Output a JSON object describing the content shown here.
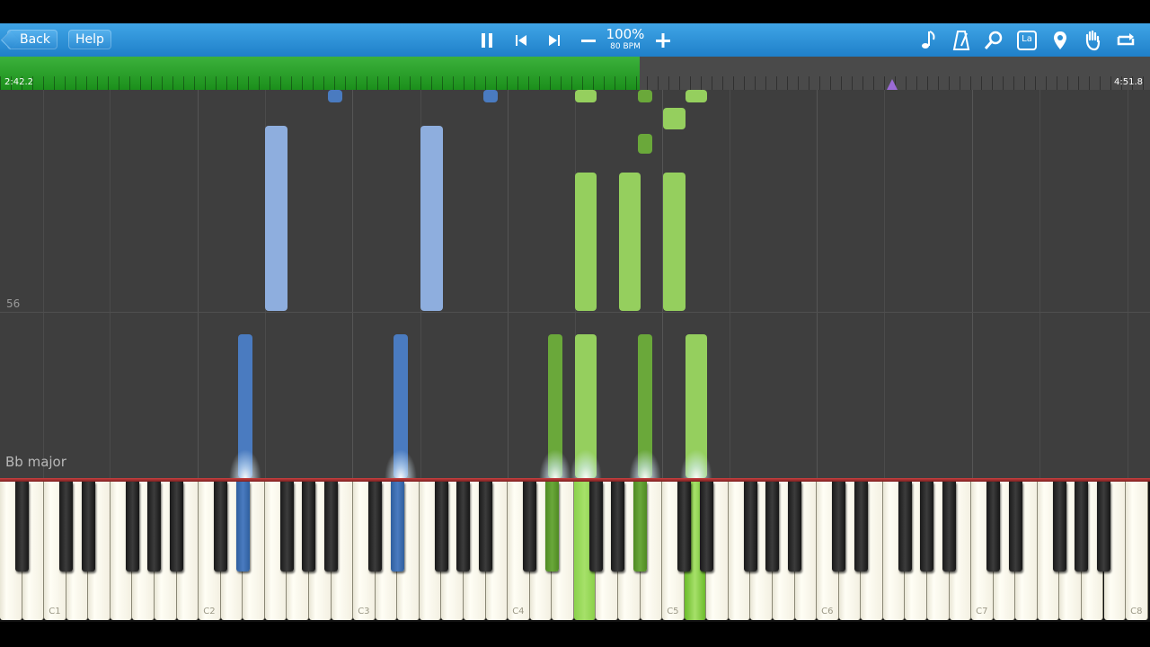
{
  "toolbar": {
    "back_label": "Back",
    "help_label": "Help",
    "speed_percent": "100%",
    "speed_bpm": "80 BPM",
    "icons": [
      "pause-icon",
      "skip-back-icon",
      "skip-forward-icon",
      "minus-icon",
      "plus-icon",
      "note-icon",
      "metronome-icon",
      "search-icon",
      "label-icon",
      "location-pin-icon",
      "hand-icon",
      "loop-icon"
    ],
    "label_icon_text": "La"
  },
  "progress": {
    "elapsed": "2:42.2",
    "total": "4:51.8",
    "fraction": 0.556,
    "marker_fraction": 0.776
  },
  "roll": {
    "measure_number": "56",
    "key_signature": "Bb major"
  },
  "keyboard": {
    "octave_labels": [
      "C1",
      "C2",
      "C3",
      "C4",
      "C5",
      "C6",
      "C7",
      "C8"
    ]
  },
  "colors": {
    "left_hand_light": "#8eaede",
    "left_hand_dark": "#4a7bc0",
    "right_hand_light": "#95cf5e",
    "right_hand_dark": "#6aa83a",
    "toolbar": "#2a8fd6",
    "progress_fill": "#2aa02a",
    "roll_background": "#3e3e3e"
  }
}
